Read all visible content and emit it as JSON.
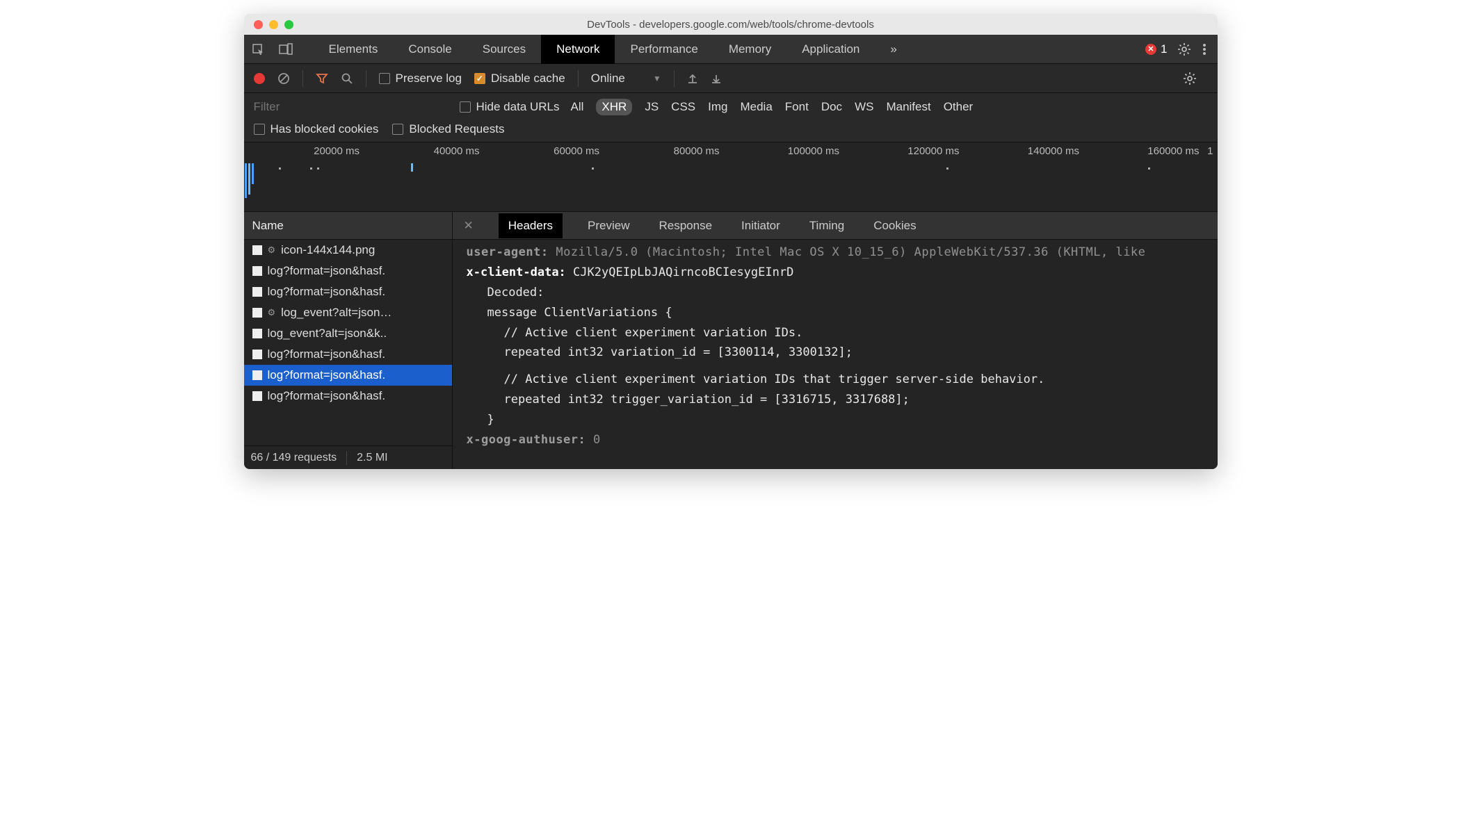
{
  "window": {
    "title": "DevTools - developers.google.com/web/tools/chrome-devtools"
  },
  "tabbar": {
    "tabs": [
      "Elements",
      "Console",
      "Sources",
      "Network",
      "Performance",
      "Memory",
      "Application"
    ],
    "active": "Network",
    "overflow": "»",
    "error_count": "1"
  },
  "toolbar": {
    "preserve_log": "Preserve log",
    "disable_cache": "Disable cache",
    "throttle": "Online"
  },
  "filter": {
    "placeholder": "Filter",
    "hide_data_urls": "Hide data URLs",
    "types": [
      "All",
      "XHR",
      "JS",
      "CSS",
      "Img",
      "Media",
      "Font",
      "Doc",
      "WS",
      "Manifest",
      "Other"
    ],
    "selected_type": "XHR",
    "has_blocked_cookies": "Has blocked cookies",
    "blocked_requests": "Blocked Requests"
  },
  "timeline": {
    "ticks": [
      "20000 ms",
      "40000 ms",
      "60000 ms",
      "80000 ms",
      "100000 ms",
      "120000 ms",
      "140000 ms",
      "160000 ms",
      "1"
    ]
  },
  "left": {
    "header": "Name",
    "requests": [
      {
        "gear": true,
        "name": "icon-144x144.png"
      },
      {
        "gear": false,
        "name": "log?format=json&hasf."
      },
      {
        "gear": false,
        "name": "log?format=json&hasf."
      },
      {
        "gear": true,
        "name": "log_event?alt=json…"
      },
      {
        "gear": false,
        "name": "log_event?alt=json&k.."
      },
      {
        "gear": false,
        "name": "log?format=json&hasf."
      },
      {
        "gear": false,
        "name": "log?format=json&hasf.",
        "selected": true
      },
      {
        "gear": false,
        "name": "log?format=json&hasf."
      }
    ],
    "status_requests": "66 / 149 requests",
    "status_size": "2.5 MI"
  },
  "right": {
    "tabs": [
      "Headers",
      "Preview",
      "Response",
      "Initiator",
      "Timing",
      "Cookies"
    ],
    "active": "Headers",
    "headers": {
      "user_agent_key": "user-agent:",
      "user_agent_val": "Mozilla/5.0 (Macintosh; Intel Mac OS X 10_15_6) AppleWebKit/537.36 (KHTML, like",
      "xcd_key": "x-client-data:",
      "xcd_val": "CJK2yQEIpLbJAQirncoBCIesygEInrD",
      "decoded": "Decoded:",
      "l1": "message ClientVariations {",
      "l2": "// Active client experiment variation IDs.",
      "l3": "repeated int32 variation_id = [3300114, 3300132];",
      "l4": "// Active client experiment variation IDs that trigger server-side behavior.",
      "l5": "repeated int32 trigger_variation_id = [3316715, 3317688];",
      "l6": "}",
      "xga_key": "x-goog-authuser:",
      "xga_val": "0"
    }
  }
}
